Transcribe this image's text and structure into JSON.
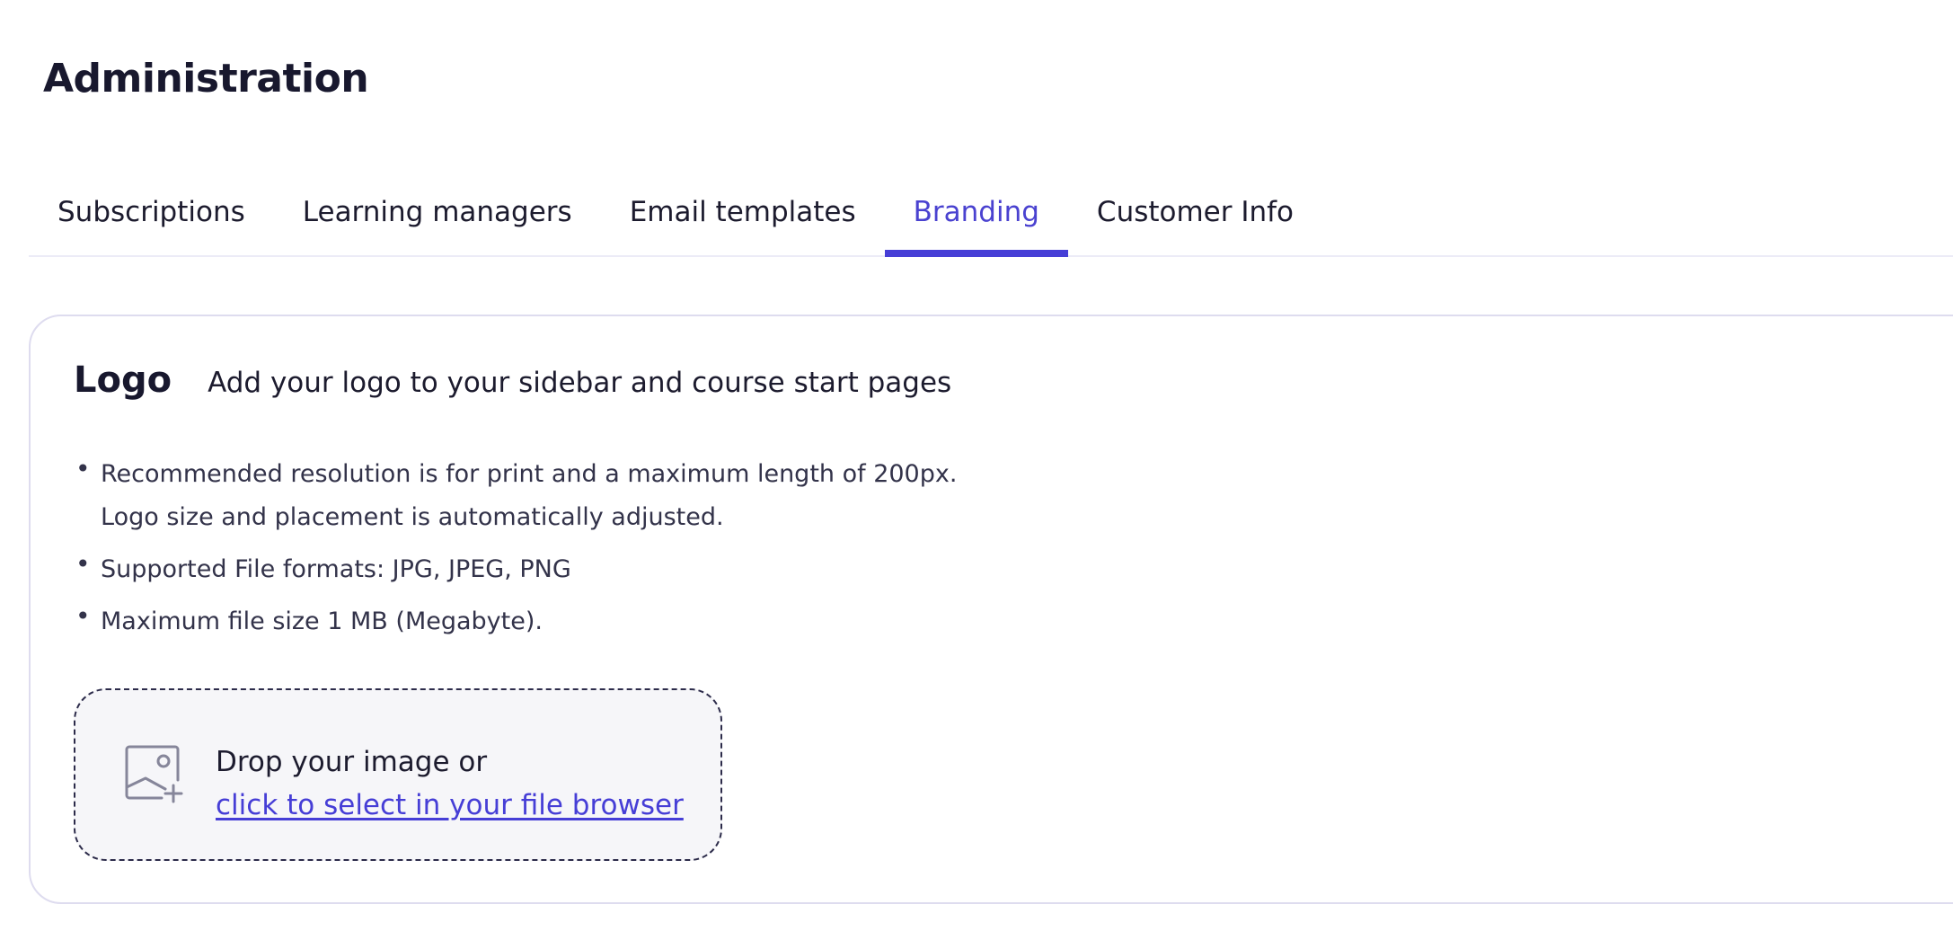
{
  "page": {
    "title": "Administration"
  },
  "tabs": [
    {
      "label": "Subscriptions",
      "active": false
    },
    {
      "label": "Learning managers",
      "active": false
    },
    {
      "label": "Email templates",
      "active": false
    },
    {
      "label": "Branding",
      "active": true
    },
    {
      "label": "Customer Info",
      "active": false
    }
  ],
  "logo_section": {
    "title": "Logo",
    "subtitle": "Add your logo to your sidebar and course start pages",
    "notes": [
      {
        "line1": "Recommended resolution is for print and a maximum length of 200px.",
        "line2": "Logo size and placement is automatically adjusted."
      },
      {
        "line1": "Supported File formats: JPG, JPEG, PNG"
      },
      {
        "line1": "Maximum file size 1 MB (Megabyte)."
      }
    ],
    "dropzone": {
      "icon": "image-add-icon",
      "prompt": "Drop your image or",
      "link_label": "click to select in your file browser"
    }
  },
  "colors": {
    "accent": "#463ed6",
    "text": "#1c1b2e",
    "card_border": "#dedcef",
    "dropzone_bg": "#f6f6f9"
  }
}
